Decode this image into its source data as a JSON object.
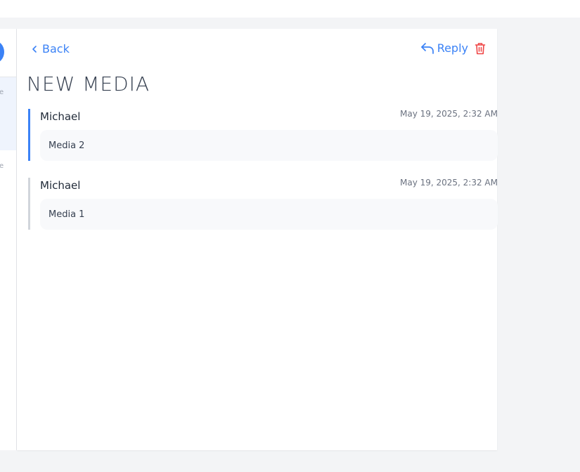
{
  "sidebar": {
    "fragments": [
      "e",
      "e"
    ]
  },
  "header": {
    "back_label": "Back",
    "reply_label": "Reply"
  },
  "thread": {
    "title": "NEW MEDIA",
    "messages": [
      {
        "author": "Michael",
        "date": "May 19, 2025, 2:32 AM",
        "body": "Media 2"
      },
      {
        "author": "Michael",
        "date": "May 19, 2025, 2:32 AM",
        "body": "Media 1"
      }
    ]
  },
  "colors": {
    "accent": "#3b82f6",
    "danger": "#ef4444",
    "page_bg": "#f3f4f6"
  },
  "icons": {
    "back": "chevron-left-icon",
    "reply": "reply-arrow-icon",
    "delete": "trash-icon"
  }
}
